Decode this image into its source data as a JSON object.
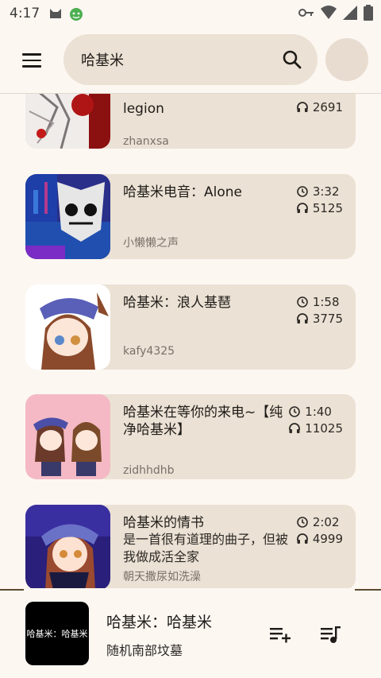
{
  "status_bar": {
    "time": "4:17"
  },
  "search": {
    "value": "哈基米"
  },
  "songs": [
    {
      "title": "legion",
      "plays": "2691",
      "author": "zhanxsa"
    },
    {
      "title": "哈基米电音：Alone",
      "duration": "3:32",
      "plays": "5125",
      "author": "小懒懒之声"
    },
    {
      "title": "哈基米：浪人基琶",
      "duration": "1:58",
      "plays": "3775",
      "author": "kafy4325"
    },
    {
      "title": "哈基米在等你的来电~【纯净哈基米】",
      "duration": "1:40",
      "plays": "11025",
      "author": "zidhhdhb"
    },
    {
      "title": "哈基米的情书",
      "subtitle": "是一首很有道理的曲子，但被我做成活全家",
      "duration": "2:02",
      "plays": "4999",
      "author": "朝天撒尿如洗澡"
    }
  ],
  "player": {
    "cover_text": "哈基米：哈基米",
    "title": "哈基米：哈基米",
    "artist": "随机南部坟墓"
  },
  "icons": [
    "menu-icon",
    "search-icon",
    "clock-icon",
    "headphones-icon",
    "playlist-add-icon",
    "queue-music-icon"
  ],
  "colors": {
    "background": "#fdf7f2",
    "card": "#ebe1d4",
    "accent": "#5c4a2e"
  }
}
